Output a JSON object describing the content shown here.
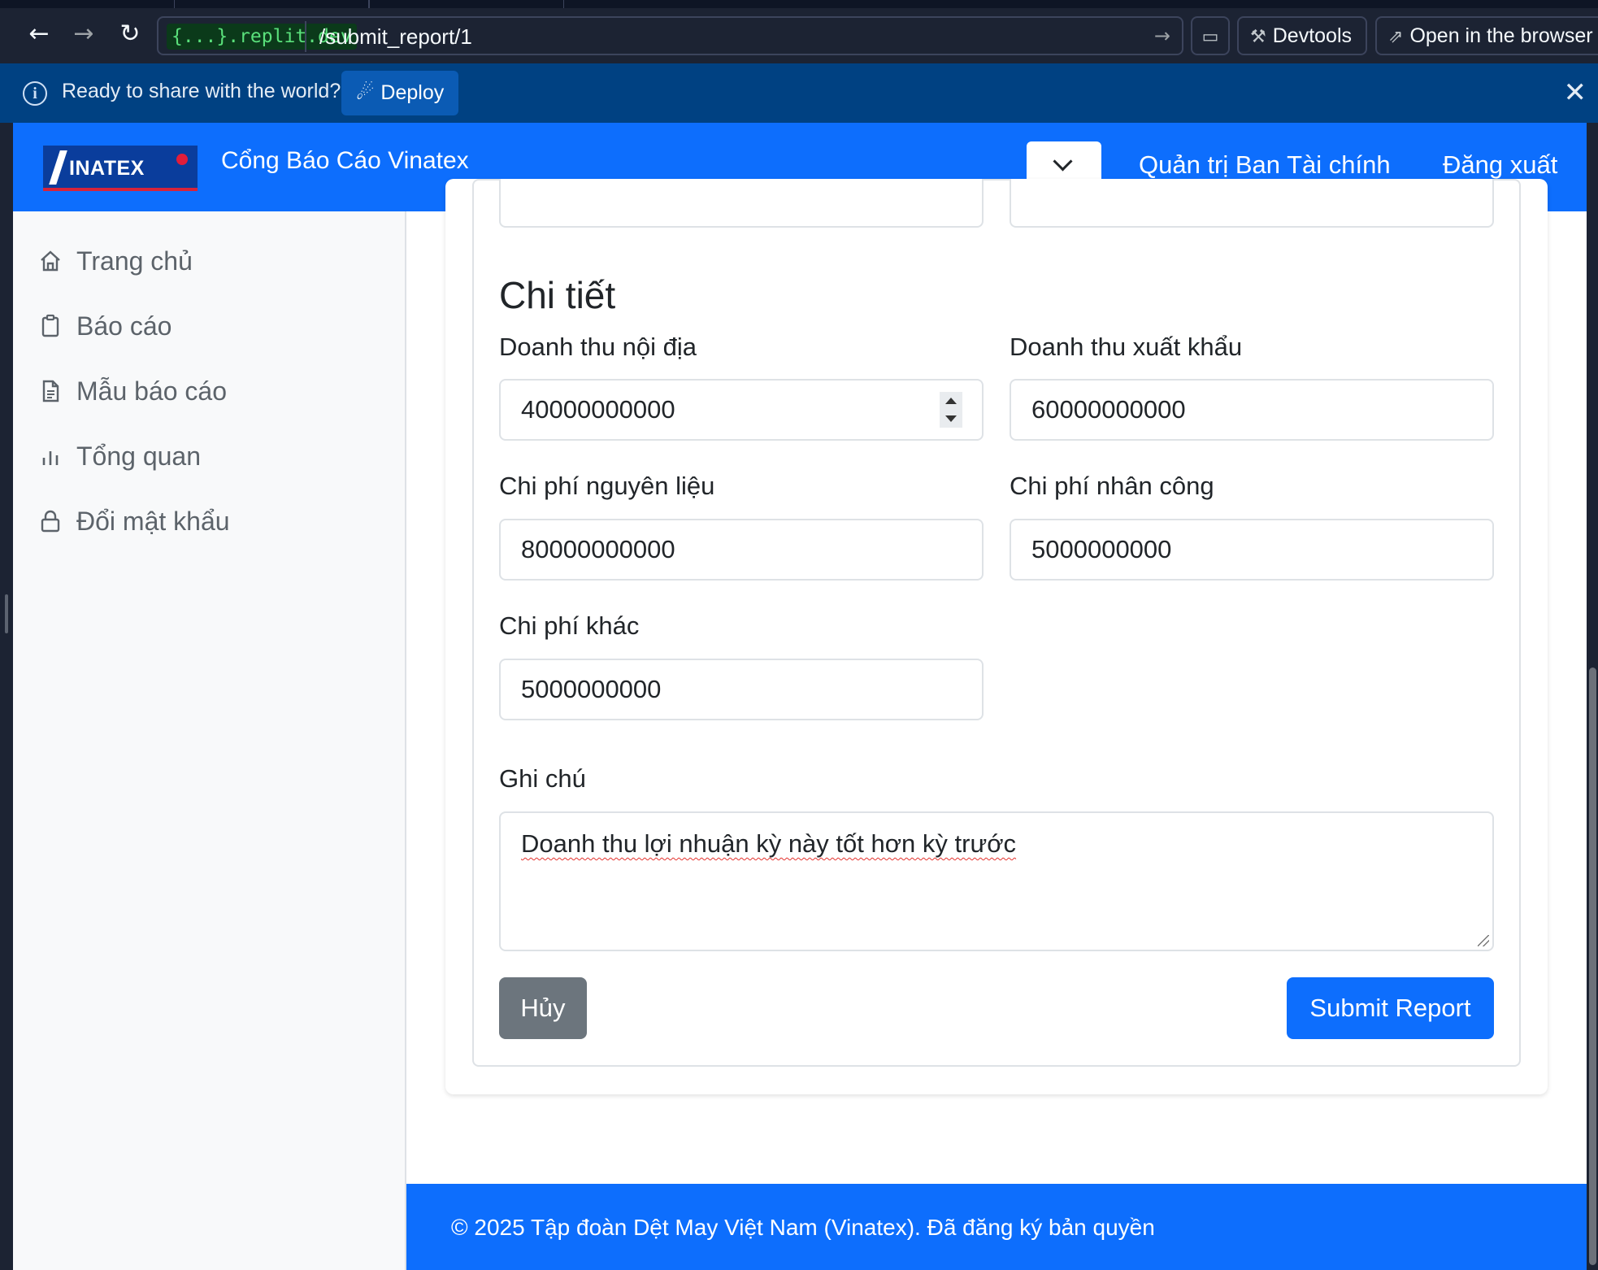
{
  "browser": {
    "url_host": "{...}.replit.dev",
    "url_path": "/submit_report/1",
    "devtools_label": "Devtools",
    "open_browser_label": "Open in the browser"
  },
  "banner": {
    "message": "Ready to share with the world?",
    "deploy_label": "Deploy"
  },
  "navbar": {
    "logo_text": "INATEX",
    "brand": "Cổng Báo Cáo Vinatex",
    "user_link": "Quản trị Ban Tài chính",
    "logout_link": "Đăng xuất"
  },
  "sidebar": {
    "items": [
      {
        "label": "Trang chủ",
        "icon": "home-icon"
      },
      {
        "label": "Báo cáo",
        "icon": "clipboard-icon"
      },
      {
        "label": "Mẫu báo cáo",
        "icon": "document-icon"
      },
      {
        "label": "Tổng quan",
        "icon": "bar-chart-icon"
      },
      {
        "label": "Đổi mật khẩu",
        "icon": "lock-icon"
      }
    ]
  },
  "form": {
    "section_title": "Chi tiết",
    "fields": {
      "domestic_revenue": {
        "label": "Doanh thu nội địa",
        "value": "40000000000"
      },
      "export_revenue": {
        "label": "Doanh thu xuất khẩu",
        "value": "60000000000"
      },
      "material_cost": {
        "label": "Chi phí nguyên liệu",
        "value": "80000000000"
      },
      "labor_cost": {
        "label": "Chi phí nhân công",
        "value": "5000000000"
      },
      "other_cost": {
        "label": "Chi phí khác",
        "value": "5000000000"
      }
    },
    "notes": {
      "label": "Ghi chú",
      "value": "Doanh thu lợi nhuận kỳ này tốt hơn kỳ trước"
    },
    "cancel_label": "Hủy",
    "submit_label": "Submit Report"
  },
  "footer": {
    "copyright": "© 2025 Tập đoàn Dệt May Việt Nam (Vinatex). Đã đăng ký bản quyền"
  }
}
